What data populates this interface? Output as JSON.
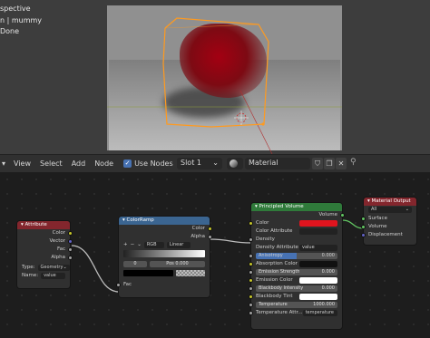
{
  "viewport": {
    "overlay_lines": [
      "spective",
      "n | mummy",
      "Done"
    ]
  },
  "header": {
    "menus": [
      "View",
      "Select",
      "Add",
      "Node"
    ],
    "use_nodes_label": "Use Nodes",
    "slot_value": "Slot 1",
    "material_name": "Material"
  },
  "nodes": {
    "attribute": {
      "title": "Attribute",
      "outputs": [
        "Color",
        "Vector",
        "Fac",
        "Alpha"
      ],
      "type_label": "Type:",
      "type_value": "Geometry",
      "name_label": "Name:",
      "name_value": "value"
    },
    "color_ramp": {
      "title": "ColorRamp",
      "outputs": [
        "Color",
        "Alpha"
      ],
      "plus": "+",
      "minus": "−",
      "dropdown": "⌄",
      "mode": "RGB",
      "interpolation": "Linear",
      "index_value": "0",
      "pos_label": "Pos",
      "pos_value": "0.000",
      "input_fac": "Fac"
    },
    "principled_volume": {
      "title": "Principled Volume",
      "output": "Volume",
      "inputs": {
        "color": "Color",
        "color_attribute": "Color Attribute",
        "density": "Density",
        "density_attribute": "Density Attribute",
        "density_attribute_value": "value",
        "anisotropy": "Anisotropy",
        "anisotropy_value": "0.000",
        "absorption_color": "Absorption Color",
        "emission_strength": "Emission Strength",
        "emission_strength_value": "0.000",
        "emission_color": "Emission Color",
        "blackbody_intensity": "Blackbody Intensity",
        "blackbody_intensity_value": "0.000",
        "blackbody_tint": "Blackbody Tint",
        "temperature": "Temperature",
        "temperature_value": "1000.000",
        "temperature_attribute": "Temperature Attr...",
        "temperature_attribute_value": "temperature"
      }
    },
    "material_output": {
      "title": "Material Output",
      "target": "All",
      "inputs": [
        "Surface",
        "Volume",
        "Displacement"
      ]
    }
  },
  "colors": {
    "volume_color": "#e0141e",
    "attribute_header": "#83262d",
    "colorramp_header": "#3b6591",
    "principled_header": "#2f7a3a",
    "output_header": "#83262d",
    "selection_orange": "#ff9a1f"
  }
}
